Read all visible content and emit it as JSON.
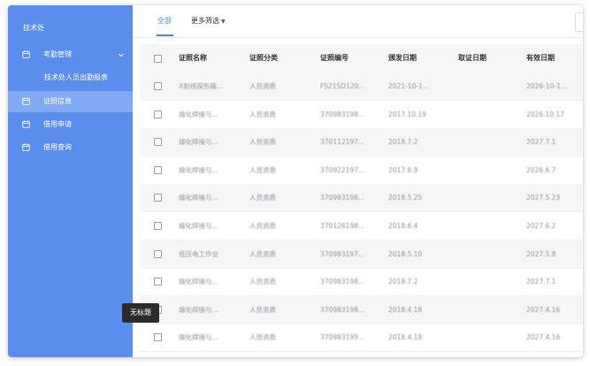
{
  "sidebar": {
    "brand": "技术处",
    "items": [
      {
        "label": "考勤管理",
        "icon": "calendar-icon",
        "expanded": true
      },
      {
        "label": "技术处人员出勤报表",
        "sub": true
      },
      {
        "label": "证照信息",
        "icon": "calendar-icon",
        "active": true
      },
      {
        "label": "借用申请",
        "icon": "calendar-icon"
      },
      {
        "label": "借用查询",
        "icon": "calendar-icon"
      }
    ]
  },
  "tabs": {
    "all": "全部",
    "more_filters": "更多筛选"
  },
  "table": {
    "headers": [
      "证照名称",
      "证照分类",
      "证照编号",
      "颁发日期",
      "取证日期",
      "有效日期"
    ],
    "rows": [
      [
        "X射线探伤辐...",
        "人员资质",
        "FS21SD120...",
        "2021-10-1...",
        "",
        "2026-10-1..."
      ],
      [
        "熔化焊接与...",
        "人员资质",
        "370983198...",
        "2017.10.19",
        "",
        "2026.10.17"
      ],
      [
        "熔化焊接与...",
        "人员资质",
        "370112197...",
        "2018.7.2",
        "",
        "2027.7.1"
      ],
      [
        "熔化焊接与...",
        "人员资质",
        "370922197...",
        "2017.6.9",
        "",
        "2026.6.7"
      ],
      [
        "熔化焊接与...",
        "人员资质",
        "370983198...",
        "2018.5.25",
        "",
        "2027.5.23"
      ],
      [
        "熔化焊接与...",
        "人员资质",
        "370126198...",
        "2018.6.4",
        "",
        "2027.6.2"
      ],
      [
        "低压电工作业",
        "人员资质",
        "370983197...",
        "2018.5.10",
        "",
        "2027.5.8"
      ],
      [
        "熔化焊接与...",
        "人员资质",
        "370983198...",
        "2018.7.2",
        "",
        "2027.7.1"
      ],
      [
        "熔化焊接与...",
        "人员资质",
        "370983198...",
        "2018.4.18",
        "",
        "2027.4.16"
      ],
      [
        "熔化焊接与...",
        "人员资质",
        "370983199...",
        "2018.4.18",
        "",
        "2027.4.16"
      ]
    ]
  },
  "tooltip": "无标题",
  "colors": {
    "sidebar_bg": "#5b8def",
    "sidebar_active": "#84a9f4",
    "accent": "#4a86ee"
  }
}
